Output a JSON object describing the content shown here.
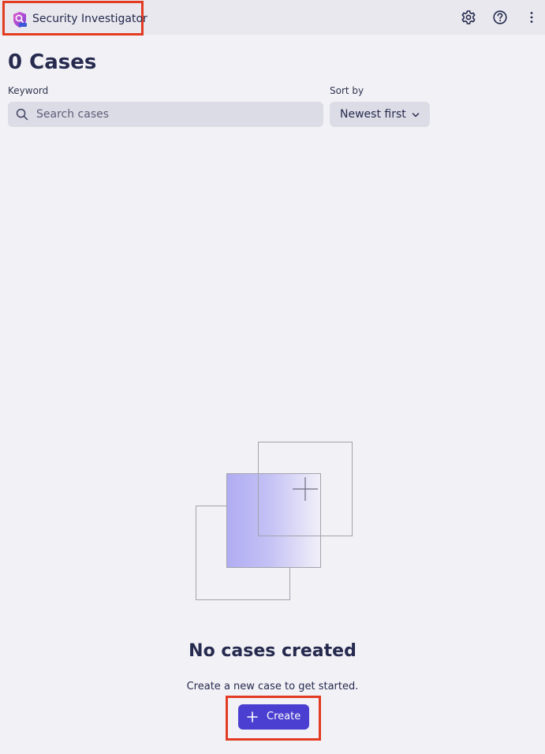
{
  "header": {
    "app_title": "Security Investigator",
    "app_icon": "security-investigator-logo",
    "actions": [
      {
        "icon": "gear-icon",
        "label": "Settings"
      },
      {
        "icon": "help-circle-icon",
        "label": "Help"
      },
      {
        "icon": "more-vertical-icon",
        "label": "More"
      }
    ]
  },
  "page": {
    "title": "0 Cases"
  },
  "filters": {
    "keyword_label": "Keyword",
    "search_placeholder": "Search cases",
    "search_value": "",
    "sort_label": "Sort by",
    "sort_value": "Newest first"
  },
  "empty_state": {
    "title": "No cases created",
    "subtitle": "Create a new case to get started.",
    "create_label": "Create",
    "create_icon": "plus-icon"
  },
  "colors": {
    "accent": "#4a3fd0",
    "highlight": "#e33b22",
    "background": "#f2f1f6",
    "topbar": "#e8e8ee",
    "text": "#252a4e"
  }
}
